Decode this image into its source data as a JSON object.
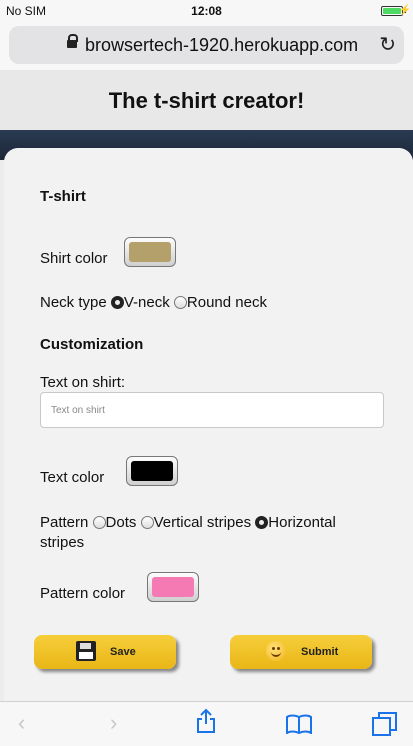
{
  "status_bar": {
    "carrier": "No SIM",
    "time": "12:08"
  },
  "browser": {
    "url": "browsertech-1920.herokuapp.com"
  },
  "page": {
    "title": "The t-shirt creator!"
  },
  "form": {
    "tshirt_heading": "T-shirt",
    "shirt_color_label": "Shirt color",
    "shirt_color": "#b3a06a",
    "neck_type_label": "Neck type",
    "neck_options": [
      "V-neck",
      "Round neck"
    ],
    "neck_selected": "V-neck",
    "customization_heading": "Customization",
    "text_on_shirt_label": "Text on shirt:",
    "text_on_shirt_placeholder": "Text on shirt",
    "text_color_label": "Text color",
    "text_color": "#000000",
    "pattern_label": "Pattern",
    "pattern_options": [
      "Dots",
      "Vertical stripes",
      "Horizontal",
      "stripes"
    ],
    "pattern_selected": "Horizontal stripes",
    "pattern_color_label": "Pattern color",
    "pattern_color": "#f57ab4"
  },
  "buttons": {
    "save": "Save",
    "submit": "Submit"
  },
  "toolbar": {
    "icons": [
      "back-icon",
      "forward-icon",
      "share-icon",
      "bookmarks-icon",
      "tabs-icon"
    ],
    "back_enabled": false,
    "forward_enabled": false
  }
}
